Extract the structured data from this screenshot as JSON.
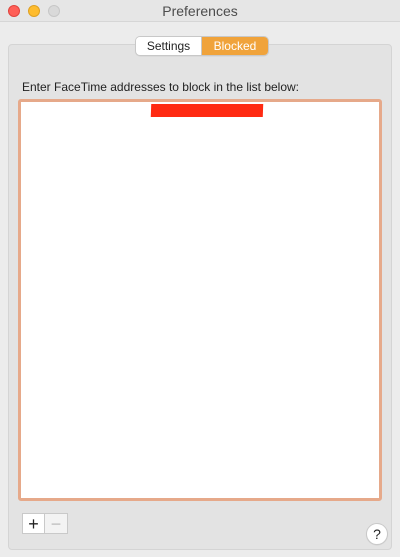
{
  "window": {
    "title": "Preferences",
    "controls": {
      "close_color": "#ff5f57",
      "minimize_color": "#febc2e",
      "zoom_color": "#d9d9d9"
    }
  },
  "tabs": [
    {
      "label": "Settings",
      "selected": false
    },
    {
      "label": "Blocked",
      "selected": true
    }
  ],
  "blocked": {
    "instructions": "Enter FaceTime addresses to block in the list below:",
    "entries": [
      {
        "value": "",
        "redacted": true
      }
    ],
    "add_button_label": "+",
    "remove_button_label": "−"
  },
  "help_button_label": "?",
  "colors": {
    "accent": "#f0a33b",
    "list_focus_border": "#e6a98a",
    "redaction": "#ff2a12"
  }
}
